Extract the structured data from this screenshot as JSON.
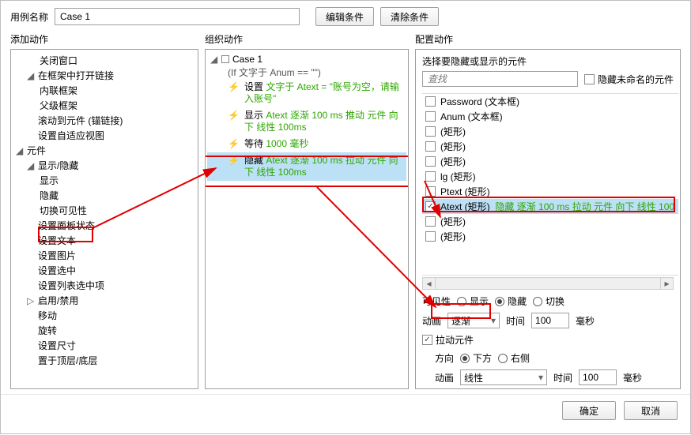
{
  "top": {
    "label": "用例名称",
    "value": "Case 1",
    "edit_cond": "编辑条件",
    "clear_cond": "清除条件"
  },
  "cols": {
    "add": "添加动作",
    "org": "组织动作",
    "cfg": "配置动作"
  },
  "left": {
    "closewin": "关闭窗口",
    "openframe": "在框架中打开链接",
    "inline": "内联框架",
    "parent": "父级框架",
    "scrollto": "滚动到元件 (锚链接)",
    "adaptive": "设置自适应视图",
    "group_widget": "元件",
    "showhide": "显示/隐藏",
    "show": "显示",
    "hide": "隐藏",
    "toggle": "切换可见性",
    "panelstate": "设置面板状态",
    "settext": "设置文本",
    "setimg": "设置图片",
    "setselected": "设置选中",
    "setlistsel": "设置列表选中项",
    "enable": "启用/禁用",
    "move": "移动",
    "rotate": "旋转",
    "setsize": "设置尺寸",
    "bringto": "置于顶层/底层"
  },
  "mid": {
    "case": "Case 1",
    "cond": "(If 文字于 Anum == \"\")",
    "a1_lbl": "设置",
    "a1_txt": "文字于 Atext = \"账号为空，请输入账号\"",
    "a2_lbl": "显示",
    "a2_txt": "Atext 逐渐 100 ms 推动 元件 向下 线性 100ms",
    "a3_lbl": "等待",
    "a3_txt": "1000 毫秒",
    "a4_lbl": "隐藏",
    "a4_txt": "Atext 逐渐 100 ms 拉动 元件 向下 线性 100ms"
  },
  "cfg": {
    "choose_lbl": "选择要隐藏或显示的元件",
    "search_ph": "查找",
    "hide_unnamed": "隐藏未命名的元件",
    "list": {
      "pwd": "Password (文本框)",
      "anum": "Anum (文本框)",
      "r1": "(矩形)",
      "r2": "(矩形)",
      "r3": "(矩形)",
      "lg": "lg (矩形)",
      "ptext": "Ptext (矩形)",
      "atext_name": "Atext (矩形)",
      "atext_detail": "隐藏 逐渐 100 ms 拉动 元件 向下 线性 100",
      "r4": "(矩形)",
      "r5": "(矩形)"
    },
    "vis_lbl": "可见性",
    "vis_show": "显示",
    "vis_hide": "隐藏",
    "vis_toggle": "切换",
    "anim_lbl": "动画",
    "anim_val": "逐渐",
    "time_lbl": "时间",
    "time_val": "100",
    "time_unit": "毫秒",
    "pull_lbl": "拉动元件",
    "dir_lbl": "方向",
    "dir_down": "下方",
    "dir_right": "右侧",
    "anim2_lbl": "动画",
    "anim2_val": "线性",
    "time2_lbl": "时间",
    "time2_val": "100",
    "time2_unit": "毫秒"
  },
  "footer": {
    "ok": "确定",
    "cancel": "取消"
  }
}
